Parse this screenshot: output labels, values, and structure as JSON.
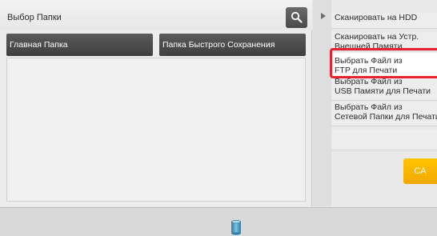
{
  "folder_panel": {
    "title": "Выбор Папки",
    "main_folder": "Главная Папка",
    "quick_folder": "Папка Быстрого Сохранения"
  },
  "menu": {
    "items": [
      {
        "line1": "Сканировать на HDD",
        "line2": ""
      },
      {
        "line1": "Сканировать на Устр.",
        "line2": "Внешней Памяти"
      },
      {
        "line1": "Выбрать Файл из",
        "line2": "FTP для Печати"
      },
      {
        "line1": "Выбрать Файл из",
        "line2": "USB Памяти для Печати"
      },
      {
        "line1": "Выбрать Файл из",
        "line2": "Сетевой Папки для Печати"
      }
    ]
  },
  "ca_button": {
    "label": "CA"
  },
  "icons": {
    "search": "search-icon",
    "storage": "storage-icon",
    "menu_arrow": "play-arrow-icon"
  },
  "colors": {
    "highlight": "#e8232e",
    "ca_button": "#f5b800",
    "folder_button": "#4a4a4a"
  }
}
